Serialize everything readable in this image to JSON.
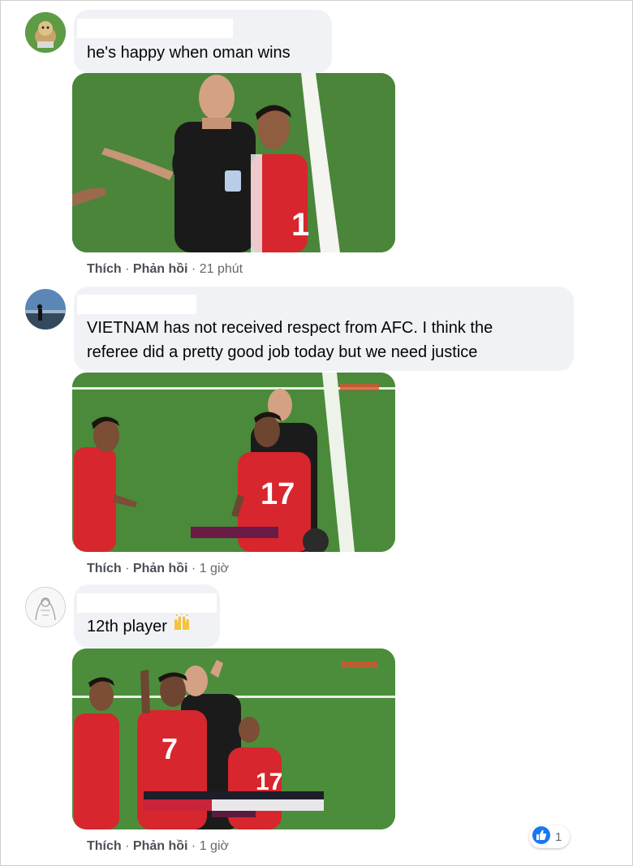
{
  "comments": [
    {
      "text_lines": [
        "he's happy when oman wins"
      ],
      "actions": {
        "like": "Thích",
        "reply": "Phản hồi",
        "time": "21 phút"
      }
    },
    {
      "text_lines": [
        "VIETNAM has not received respect from AFC. I think the",
        "referee did a pretty good job today but we need justice"
      ],
      "actions": {
        "like": "Thích",
        "reply": "Phản hồi",
        "time": "1 giờ"
      },
      "media": {
        "jersey_number": "17"
      }
    },
    {
      "text_lines": [
        "12th player"
      ],
      "emoji": "raised-hands-icon",
      "actions": {
        "like": "Thích",
        "reply": "Phản hồi",
        "time": "1 giờ"
      },
      "media": {
        "jersey_numbers": [
          "7",
          "17"
        ]
      },
      "reaction": {
        "icon": "like-icon",
        "count": "1"
      }
    }
  ],
  "separator": "·",
  "colors": {
    "bubble": "#f0f2f5",
    "like_blue": "#1877f2",
    "pitch": "#3f7d36",
    "oman_red": "#d7262d"
  }
}
